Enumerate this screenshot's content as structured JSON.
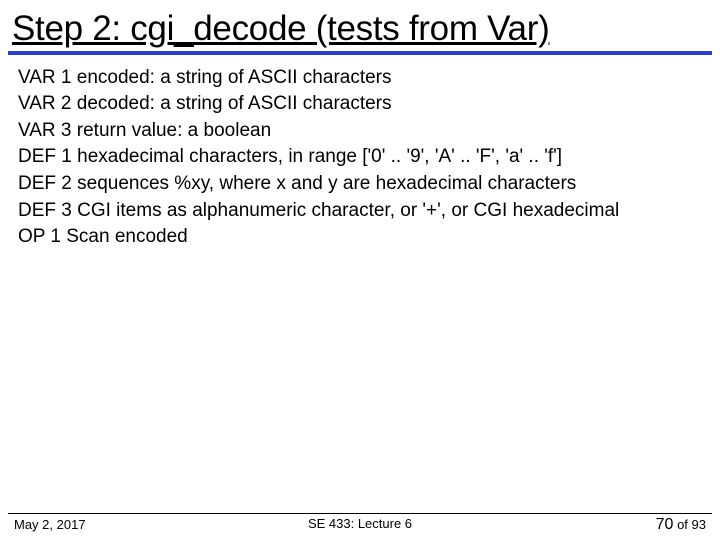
{
  "title": "Step 2: cgi_decode (tests from Var)",
  "lines": [
    "VAR 1 encoded: a string of ASCII characters",
    "VAR 2 decoded: a string of ASCII characters",
    "VAR 3 return value: a boolean",
    "DEF 1 hexadecimal characters, in range  ['0' .. '9', 'A' .. 'F', 'a' .. 'f']",
    "DEF 2 sequences %xy, where x and y are hexadecimal characters",
    "DEF 3 CGI items as alphanumeric character, or '+', or CGI hexadecimal",
    "OP 1 Scan encoded"
  ],
  "footer": {
    "date": "May 2, 2017",
    "course": "SE 433: Lecture 6",
    "page_current": "70",
    "page_sep": " of ",
    "page_total": "93"
  }
}
